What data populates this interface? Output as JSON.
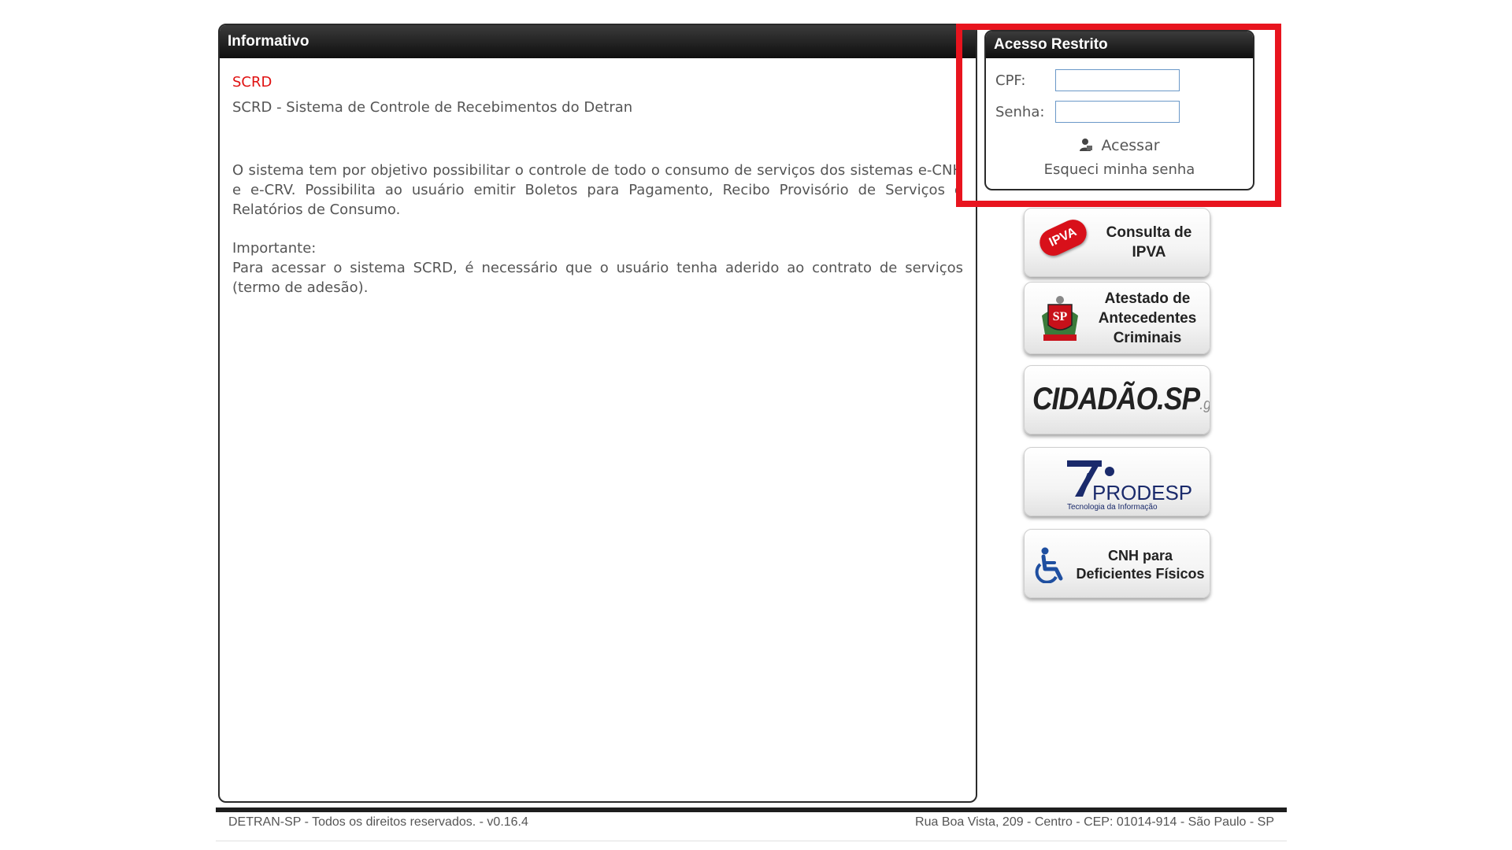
{
  "info": {
    "header": "Informativo",
    "title": "SCRD",
    "subtitle": "SCRD - Sistema de Controle de Recebimentos do Detran",
    "paragraph": "O sistema tem por objetivo possibilitar o controle de todo o consumo de serviços dos sistemas e-CNH e e-CRV. Possibilita ao usuário emitir Boletos para Pagamento, Recibo Provisório de Serviços e Relatórios de Consumo.",
    "important_label": "Importante:",
    "important_text": "Para acessar o sistema SCRD, é necessário que o usuário tenha aderido ao contrato de serviços (termo de adesão)."
  },
  "access": {
    "header": "Acesso Restrito",
    "cpf_label": "CPF:",
    "cpf_value": "",
    "senha_label": "Senha:",
    "senha_value": "",
    "acessar_label": "Acessar",
    "forgot_label": "Esqueci minha senha",
    "user_icon": "user-lock-icon",
    "highlight_color": "#e8141e"
  },
  "side_buttons": {
    "ipva": {
      "badge": "IPVA",
      "line1": "Consulta de",
      "line2": "IPVA"
    },
    "atestado": {
      "seal": "SP",
      "line1": "Atestado de",
      "line2": "Antecedentes",
      "line3": "Criminais"
    },
    "cidadao": {
      "logo_main": "CIDADÃO.SP",
      "logo_suffix": ".gov.br"
    },
    "prodesp": {
      "logo_main": "PRODESP",
      "logo_sub": "Tecnologia da Informação"
    },
    "cnh": {
      "icon": "wheelchair-icon",
      "line1": "CNH para",
      "line2": "Deficientes Físicos"
    }
  },
  "footer": {
    "left": "DETRAN-SP - Todos os direitos reservados. - v0.16.4",
    "right": "Rua Boa Vista, 209 - Centro - CEP: 01014-914 - São Paulo - SP"
  }
}
